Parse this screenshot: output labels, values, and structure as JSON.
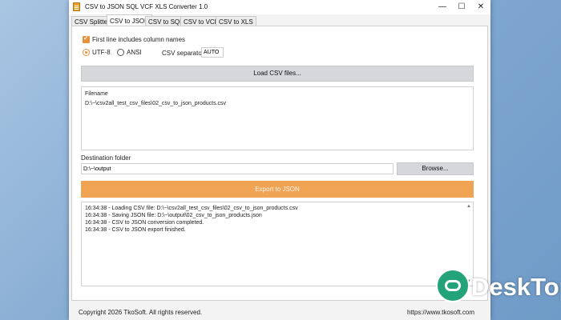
{
  "window": {
    "title": "CSV to JSON SQL VCF XLS Converter 1.0",
    "minimize": "—",
    "maximize": "☐",
    "close": "✕"
  },
  "tabs": [
    {
      "label": "CSV Splitter",
      "active": false
    },
    {
      "label": "CSV to JSON",
      "active": true
    },
    {
      "label": "CSV to SQL",
      "active": false
    },
    {
      "label": "CSV to VCF",
      "active": false
    },
    {
      "label": "CSV to XLS",
      "active": false
    }
  ],
  "options": {
    "first_line_label": "First line includes column names",
    "first_line_checked": true,
    "encoding_utf8": "UTF-8",
    "encoding_ansi": "ANSI",
    "encoding_selected": "UTF-8",
    "separator_label": "CSV separator",
    "separator_value": "AUTO"
  },
  "load_button": "Load CSV files...",
  "file_list": {
    "header": "Filename",
    "rows": [
      "D:\\~\\csv2all_test_csv_files\\02_csv_to_json_products.csv"
    ]
  },
  "destination": {
    "label": "Destination folder",
    "value": "D:\\~\\output",
    "browse_button": "Browse..."
  },
  "export_button": "Export to JSON",
  "log": [
    "16:34:38 - Loading CSV file: D:\\~\\csv2all_test_csv_files\\02_csv_to_json_products.csv",
    "16:34:38 - Saving JSON file: D:\\~\\output\\02_csv_to_json_products.json",
    "16:34:38 - CSV to JSON conversion completed.",
    "16:34:38 - CSV to JSON export finished."
  ],
  "status": {
    "copyright": "Copyright 2026 TkoSoft. All rights reserved.",
    "website": "https://www.tkosoft.com"
  },
  "watermark": {
    "text": "DeskTop",
    "icon": "desktop-logo-icon"
  },
  "colors": {
    "accent": "#e8913a",
    "export_button": "#f0a352",
    "watermark": "#23a37a"
  }
}
